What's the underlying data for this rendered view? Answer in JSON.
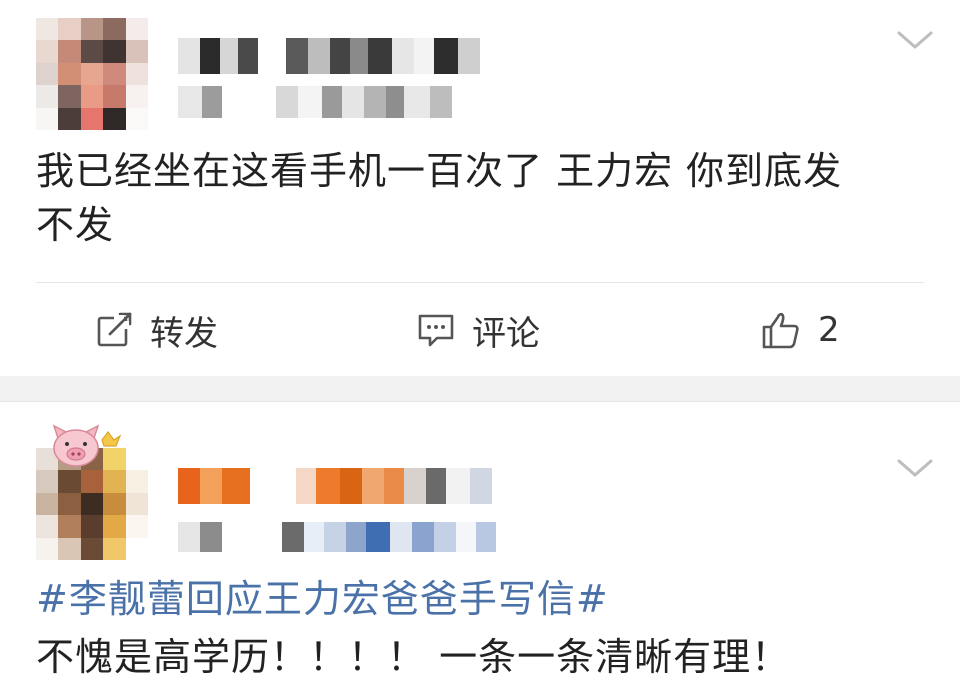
{
  "posts": [
    {
      "content": "我已经坐在这看手机一百次了 王力宏 你到底发\n不发",
      "actions": {
        "repost": "转发",
        "comment": "评论",
        "like_count": "2"
      }
    },
    {
      "hashtag": "#李靓蕾回应王力宏爸爸手写信#",
      "content": "不愧是高学历！！！！ 一条一条清晰有理！"
    }
  ],
  "icons": {
    "menu": "chevron-down-icon",
    "repost": "repost-icon",
    "comment": "comment-icon",
    "like": "thumbs-up-icon",
    "badge": "pig-icon"
  },
  "colors": {
    "hashtag": "#4b72a8",
    "icon": "#555555",
    "separator": "#f2f2f2"
  }
}
